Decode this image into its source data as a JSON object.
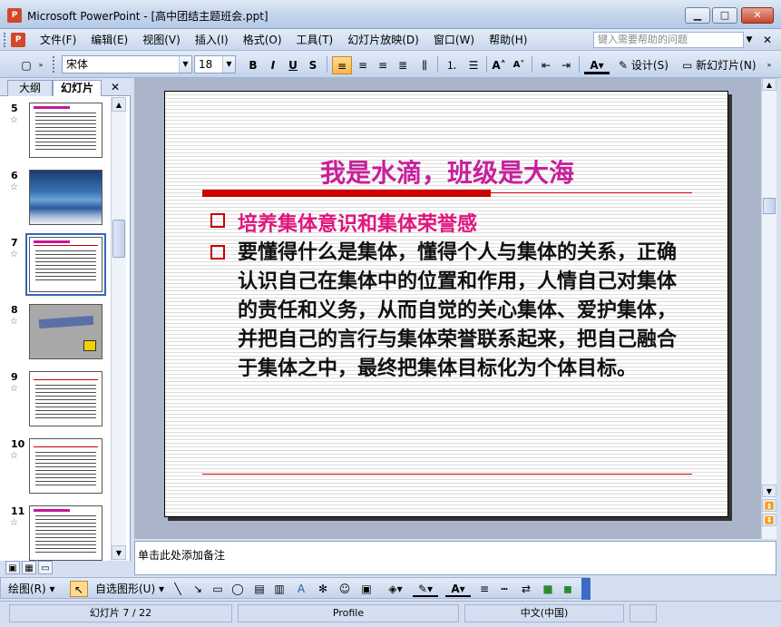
{
  "window": {
    "title": "Microsoft PowerPoint - [高中团结主题班会.ppt]",
    "app_icon_text": "P"
  },
  "menu": {
    "items": [
      "文件(F)",
      "编辑(E)",
      "视图(V)",
      "插入(I)",
      "格式(O)",
      "工具(T)",
      "幻灯片放映(D)",
      "窗口(W)",
      "帮助(H)"
    ],
    "help_placeholder": "键入需要帮助的问题"
  },
  "format_toolbar": {
    "font": "宋体",
    "size": "18",
    "bold": "B",
    "italic": "I",
    "underline": "U",
    "shadow": "S",
    "design_label": "设计(S)",
    "new_slide_label": "新幻灯片(N)"
  },
  "left_pane": {
    "tab_outline": "大纲",
    "tab_slides": "幻灯片",
    "thumbnails": [
      {
        "num": "5"
      },
      {
        "num": "6"
      },
      {
        "num": "7"
      },
      {
        "num": "8"
      },
      {
        "num": "9"
      },
      {
        "num": "10"
      },
      {
        "num": "11"
      }
    ],
    "selected_index": 2
  },
  "slide": {
    "title": "我是水滴，班级是大海",
    "bullet1": "培养集体意识和集体荣誉感",
    "bullet2": "要懂得什么是集体，懂得个人与集体的关系，正确认识自己在集体中的位置和作用，人情自己对集体的责任和义务，从而自觉的关心集体、爱护集体，并把自己的言行与集体荣誉联系起来，把自己融合于集体之中，最终把集体目标化为个体目标。",
    "colors": {
      "title": "#c8209b",
      "bullet1": "#e0157c",
      "accent": "#cc0000"
    }
  },
  "notes": {
    "placeholder": "单击此处添加备注"
  },
  "draw_toolbar": {
    "draw_label": "绘图(R)",
    "autoshape_label": "自选图形(U)"
  },
  "status": {
    "slide_pos": "幻灯片 7 / 22",
    "design": "Profile",
    "language": "中文(中国)"
  }
}
